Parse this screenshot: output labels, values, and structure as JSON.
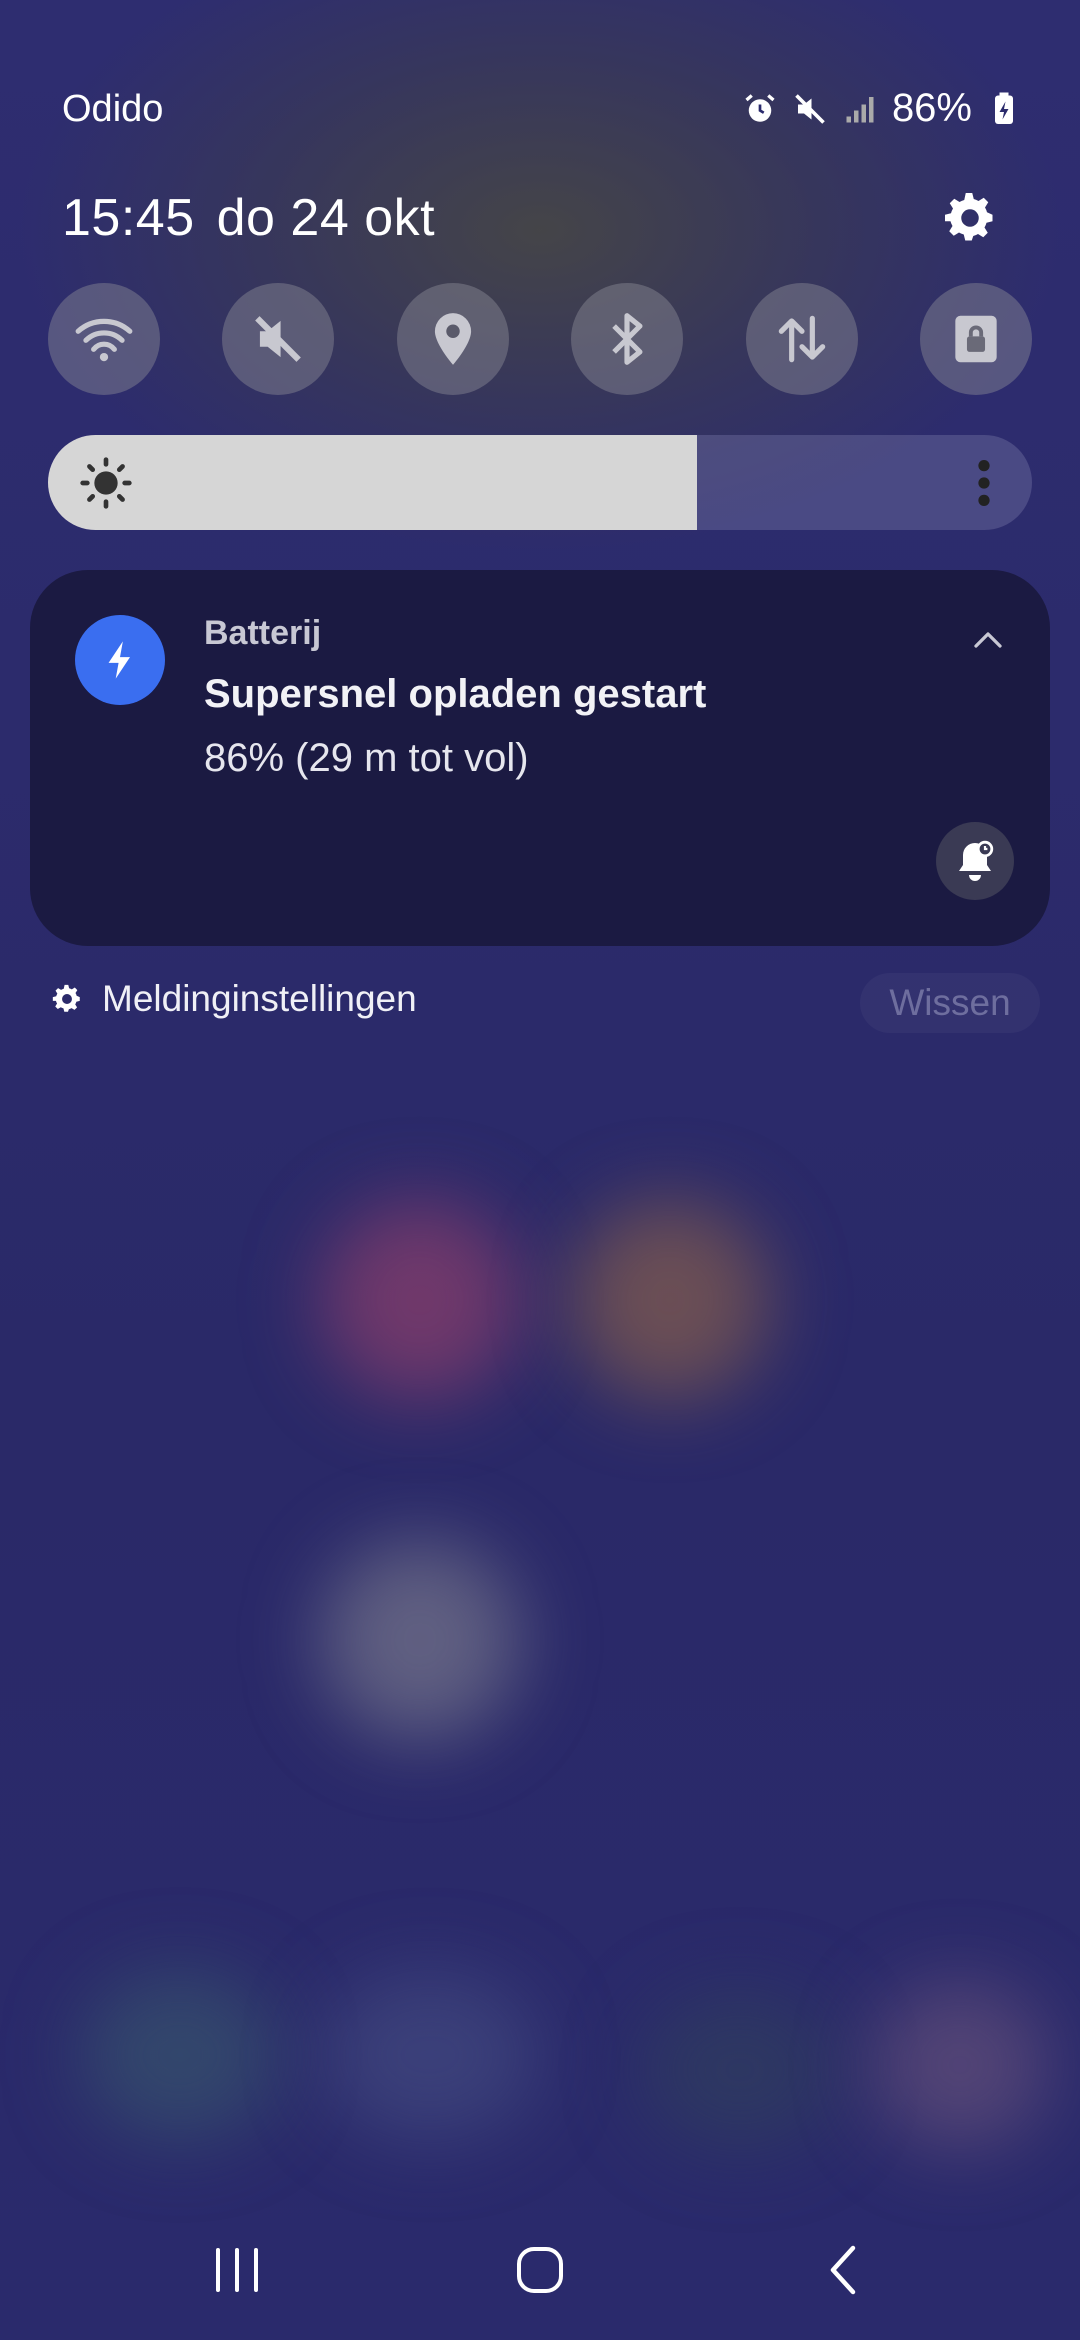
{
  "status_bar": {
    "carrier": "Odido",
    "battery_percent": "86%",
    "icons": [
      "alarm-icon",
      "mute-icon",
      "signal-icon",
      "battery-charging-icon"
    ]
  },
  "header": {
    "time": "15:45",
    "date": "do 24 okt"
  },
  "quick_settings": [
    {
      "name": "wifi",
      "icon": "wifi-icon"
    },
    {
      "name": "sound",
      "icon": "mute-icon"
    },
    {
      "name": "location",
      "icon": "location-icon"
    },
    {
      "name": "bluetooth",
      "icon": "bluetooth-icon"
    },
    {
      "name": "mobile-data",
      "icon": "data-arrows-icon"
    },
    {
      "name": "rotation-lock",
      "icon": "rotation-lock-icon"
    }
  ],
  "brightness": {
    "level": 0.66
  },
  "notification": {
    "app_name": "Batterij",
    "title": "Supersnel opladen gestart",
    "body": "86% (29 m tot vol)",
    "icon_color": "#3a6ef0"
  },
  "footer": {
    "settings_label": "Meldinginstellingen",
    "clear_label": "Wissen"
  },
  "colors": {
    "background": "#2a2a6c",
    "notification_bg": "#1b1a42",
    "accent": "#3a6ef0"
  }
}
